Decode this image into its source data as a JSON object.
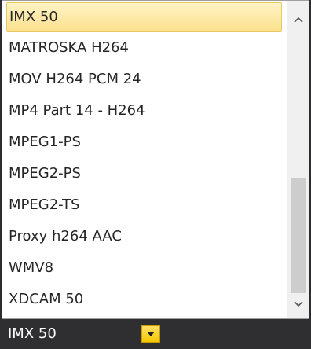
{
  "dropdown": {
    "items": [
      {
        "label": "IMX 50",
        "selected": true
      },
      {
        "label": "MATROSKA H264"
      },
      {
        "label": "MOV H264 PCM 24"
      },
      {
        "label": "MP4 Part 14 - H264"
      },
      {
        "label": "MPEG1-PS"
      },
      {
        "label": "MPEG2-PS"
      },
      {
        "label": "MPEG2-TS"
      },
      {
        "label": "Proxy h264 AAC"
      },
      {
        "label": "WMV8"
      },
      {
        "label": "XDCAM 50"
      }
    ],
    "scroll_up_icon": "chevron-up-icon",
    "scroll_down_icon": "chevron-down-icon"
  },
  "combo": {
    "value": "IMX 50",
    "button_icon": "caret-down-icon"
  },
  "colors": {
    "selected_highlight": "#fbe08e",
    "combo_button": "#f5c800",
    "combo_background": "#2f2f31"
  }
}
